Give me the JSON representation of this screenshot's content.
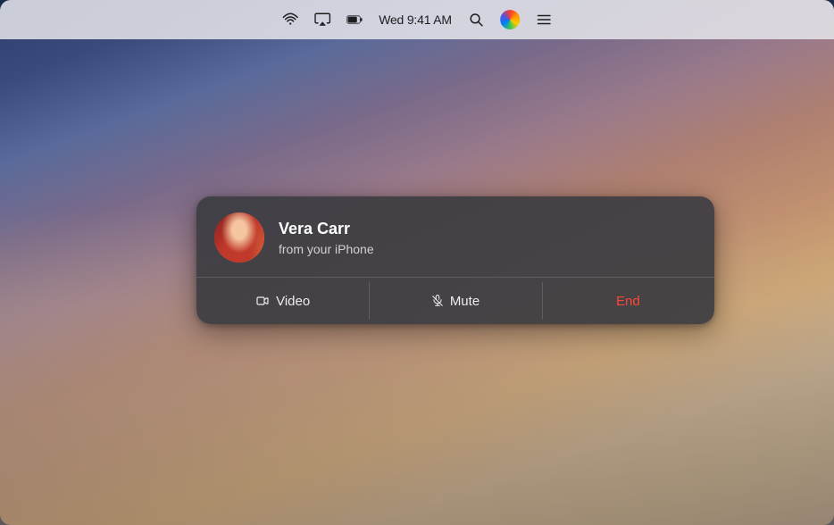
{
  "desktop": {
    "bg_description": "macOS sunset desktop background"
  },
  "menubar": {
    "time": "Wed 9:41 AM",
    "icons": {
      "wifi": "wifi-icon",
      "airplay": "airplay-icon",
      "battery": "battery-icon",
      "search": "search-icon",
      "siri": "siri-icon",
      "control_center": "control-center-icon"
    }
  },
  "notification": {
    "caller_name": "Vera Carr",
    "caller_subtitle": "from your iPhone",
    "actions": {
      "video": "Video",
      "mute": "Mute",
      "end": "End"
    }
  }
}
